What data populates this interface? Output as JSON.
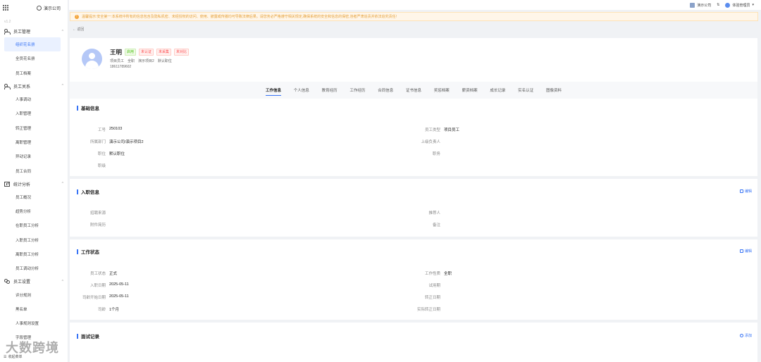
{
  "sidebar": {
    "company": "演示公司",
    "version": "v1.2",
    "groups": [
      {
        "label": "员工管理",
        "icon": "people-icon",
        "items": [
          "组织花名册",
          "全员花名册",
          "员工档案"
        ]
      },
      {
        "label": "员工关系",
        "icon": "people-icon",
        "items": [
          "人事调动",
          "入职管理",
          "转正管理",
          "离职管理",
          "异动记录",
          "员工合同"
        ]
      },
      {
        "label": "统计分析",
        "icon": "chart-icon",
        "items": [
          "员工概况",
          "趋势分析",
          "在职员工分析",
          "入职员工分析",
          "离职员工分析",
          "员工调动分析"
        ]
      },
      {
        "label": "员工设置",
        "icon": "settings-icon",
        "items": [
          "评分规则",
          "黑名单",
          "人事规则设置",
          "字段管理"
        ]
      }
    ],
    "bottom": "收起菜单"
  },
  "topbar": {
    "company": "演示公司",
    "user": "体验管理员"
  },
  "notice": "温馨提示:安全第一:本系统中所有的信息包含及隐私机密、未经授权的访问、使用、披露或传播均可导致法律后果。请您务必严格遵守相关规定,确保系统的安全和信息的保密,违者严肃追责并依法追究责任!",
  "back": "返回",
  "profile": {
    "name": "王明",
    "tags": [
      {
        "text": "启用",
        "color": "green"
      },
      {
        "text": "未认证",
        "color": "red"
      },
      {
        "text": "未采集",
        "color": "red"
      },
      {
        "text": "未对比",
        "color": "red"
      }
    ],
    "meta": [
      "项目员工",
      "全职",
      "演示项目2",
      "默认职位"
    ],
    "phone": "18611789602"
  },
  "tabs": [
    "工作信息",
    "个人信息",
    "教育经历",
    "工作经历",
    "合同信息",
    "证书信息",
    "奖惩档案",
    "薪资档案",
    "成长记录",
    "实名认证",
    "图像资料"
  ],
  "basic": {
    "title": "基础信息",
    "left": [
      [
        "工号",
        "250103"
      ],
      [
        "所属部门",
        "演示公司/演示项目2"
      ],
      [
        "职位",
        "默认职位"
      ],
      [
        "职级",
        ""
      ]
    ],
    "right": [
      [
        "员工类型",
        "项目员工"
      ],
      [
        "上级负责人",
        ""
      ],
      [
        "职务",
        ""
      ]
    ]
  },
  "onboard": {
    "title": "入职信息",
    "action": "编辑",
    "left": [
      [
        "招聘来源",
        ""
      ],
      [
        "附件简历",
        ""
      ]
    ],
    "right": [
      [
        "推荐人",
        ""
      ],
      [
        "备注",
        ""
      ]
    ]
  },
  "workstatus": {
    "title": "工作状态",
    "action": "编辑",
    "left": [
      [
        "员工状态",
        "正式"
      ],
      [
        "入职日期",
        "2025-05-11"
      ],
      [
        "司龄开始日期",
        "2025-05-11"
      ],
      [
        "司龄",
        "1个月"
      ]
    ],
    "right": [
      [
        "工作性质",
        "全职"
      ],
      [
        "试用期",
        ""
      ],
      [
        "转正日期",
        ""
      ],
      [
        "实际转正日期",
        ""
      ]
    ]
  },
  "interview": {
    "title": "面试记录",
    "action": "添加"
  },
  "watermark": "大数跨境"
}
